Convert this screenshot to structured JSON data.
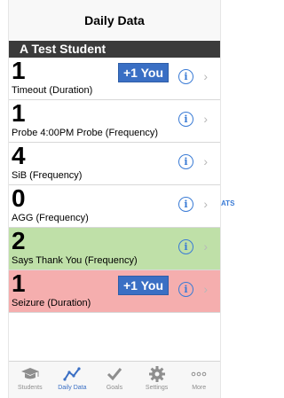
{
  "navbar": {
    "title": "Daily Data"
  },
  "student": {
    "name": "A Test Student"
  },
  "rows": [
    {
      "count": "1",
      "label": "Timeout (Duration)",
      "button": "+1 You",
      "info_icon": "info-icon",
      "chevron_icon": "chevron-right-icon"
    },
    {
      "count": "1",
      "label": "Probe 4:00PM Probe (Frequency)",
      "info_icon": "info-icon",
      "chevron_icon": "chevron-right-icon"
    },
    {
      "count": "4",
      "label": "SiB (Frequency)",
      "info_icon": "info-icon",
      "chevron_icon": "chevron-right-icon"
    },
    {
      "count": "0",
      "label": "AGG (Frequency)",
      "info_icon": "info-icon",
      "chevron_icon": "chevron-right-icon"
    },
    {
      "count": "2",
      "label": "Says Thank You (Frequency)",
      "info_icon": "info-icon",
      "chevron_icon": "chevron-right-icon"
    },
    {
      "count": "1",
      "label": "Seizure (Duration)",
      "button": "+1 You",
      "info_icon": "info-icon",
      "chevron_icon": "chevron-right-icon"
    }
  ],
  "side_text": "ATS",
  "info_glyph": "i",
  "chevron_glyph": "›",
  "tabs": [
    {
      "label": "Students",
      "icon": "graduation-cap-icon"
    },
    {
      "label": "Daily Data",
      "icon": "line-chart-icon",
      "active": true
    },
    {
      "label": "Goals",
      "icon": "checkmark-icon"
    },
    {
      "label": "Settings",
      "icon": "gear-icon"
    },
    {
      "label": "More",
      "icon": "more-dots-icon"
    }
  ],
  "colors": {
    "header_bg": "#3b3b3b",
    "green_row": "#bfe0a8",
    "red_row": "#f5aeae",
    "accent_blue": "#3a6fc4"
  }
}
